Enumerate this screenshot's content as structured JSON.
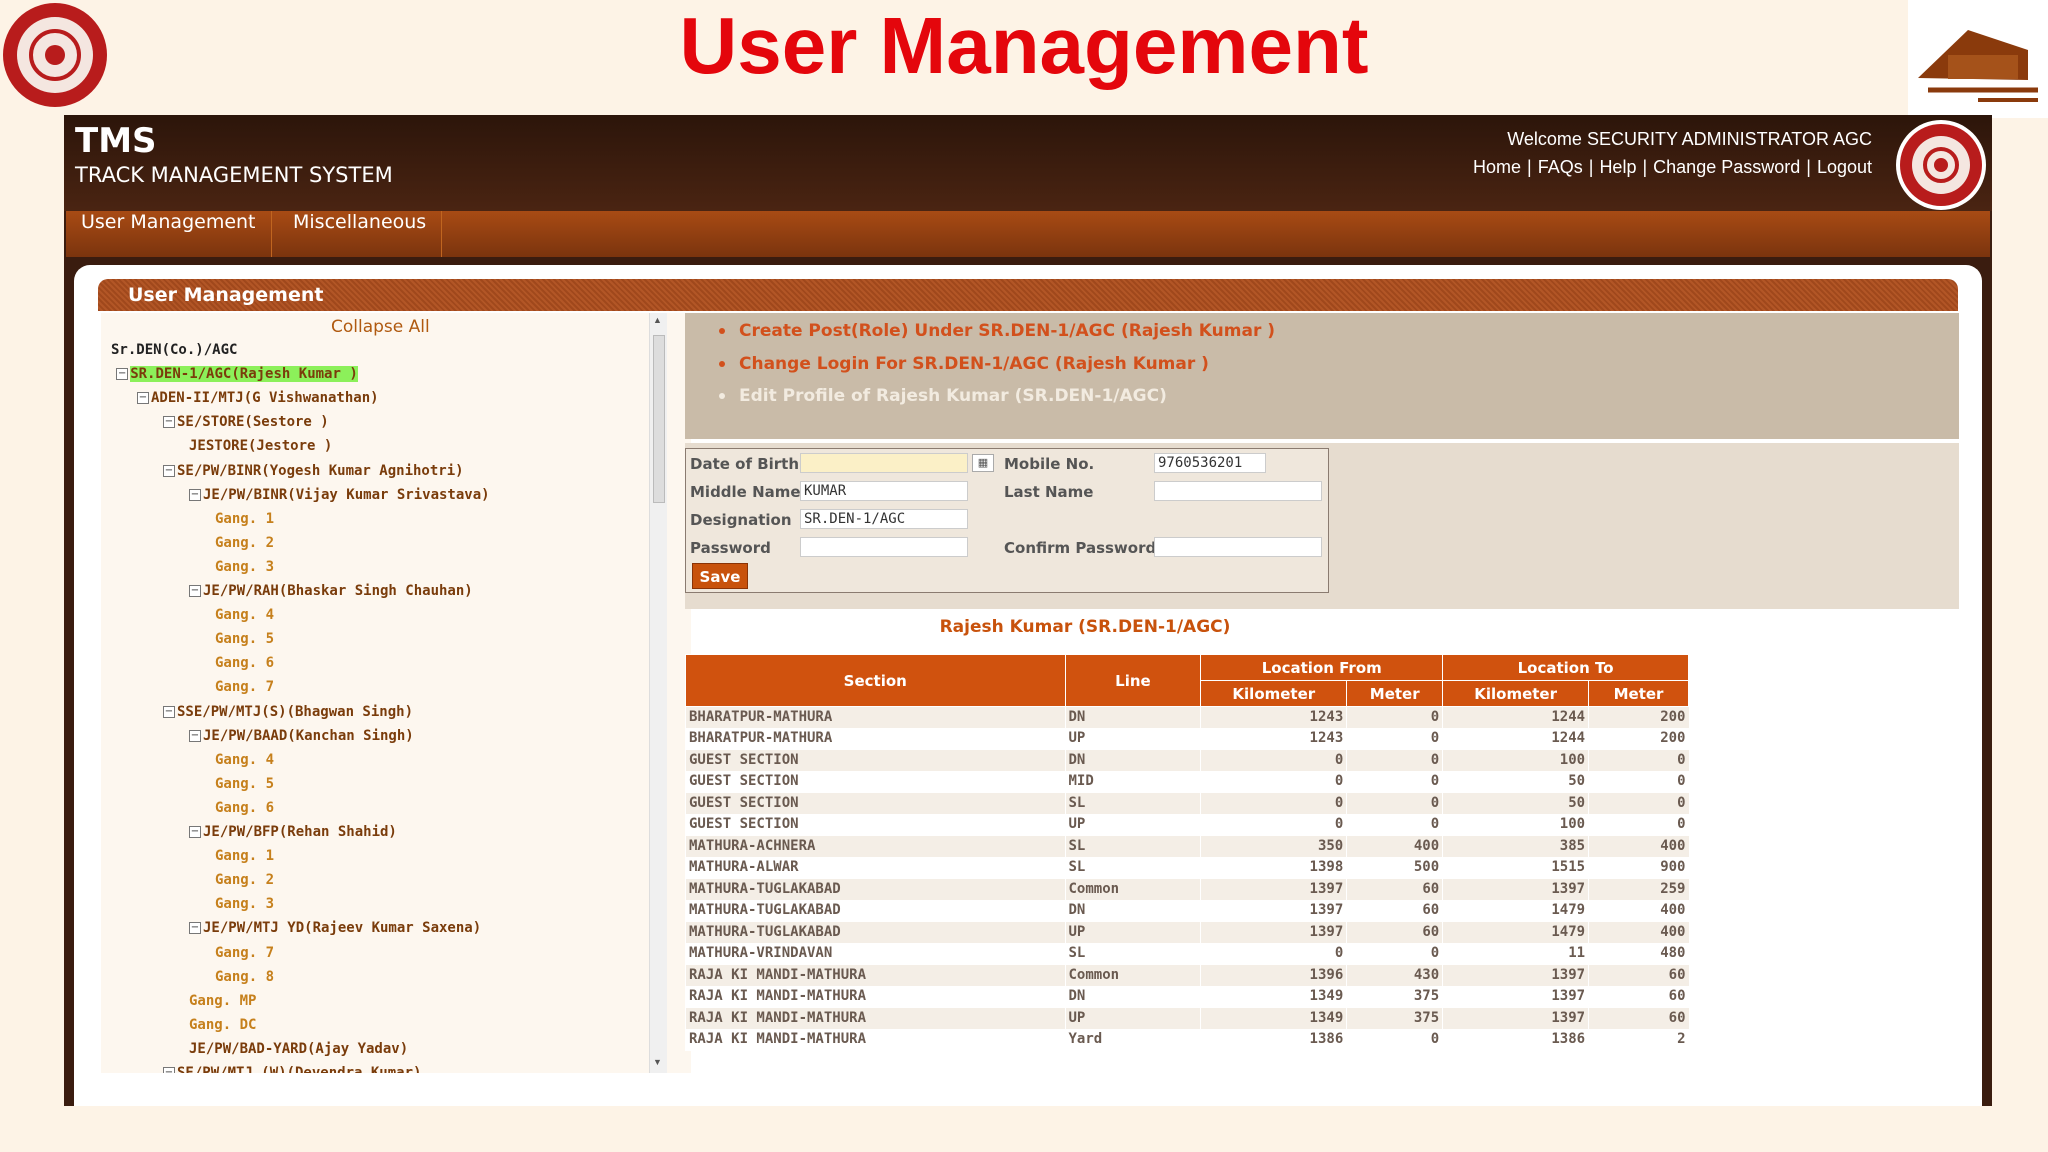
{
  "slide": {
    "title": "User Management"
  },
  "header": {
    "app_name": "TMS",
    "app_subtitle": "TRACK MANAGEMENT SYSTEM",
    "welcome": "Welcome SECURITY ADMINISTRATOR AGC",
    "links": [
      "Home",
      "FAQs",
      "Help",
      "Change Password",
      "Logout"
    ]
  },
  "nav": {
    "items": [
      "User Management",
      "Miscellaneous"
    ]
  },
  "panel": {
    "title": "User Management"
  },
  "tree": {
    "collapse_label": "Collapse All",
    "nodes": [
      {
        "label": "Sr.DEN(Co.)/AGC",
        "level": 0,
        "kind": "root"
      },
      {
        "label": "SR.DEN-1/AGC(Rajesh Kumar )",
        "level": 0,
        "kind": "selected",
        "toggle": "−"
      },
      {
        "label": "ADEN-II/MTJ(G Vishwanathan)",
        "level": 1,
        "toggle": "−"
      },
      {
        "label": "SE/STORE(Sestore )",
        "level": 2,
        "toggle": "−"
      },
      {
        "label": "JESTORE(Jestore )",
        "level": 3
      },
      {
        "label": "SE/PW/BINR(Yogesh Kumar Agnihotri)",
        "level": 2,
        "toggle": "−"
      },
      {
        "label": "JE/PW/BINR(Vijay Kumar Srivastava)",
        "level": 3,
        "toggle": "−"
      },
      {
        "label": "Gang. 1",
        "level": 4,
        "kind": "gang"
      },
      {
        "label": "Gang. 2",
        "level": 4,
        "kind": "gang"
      },
      {
        "label": "Gang. 3",
        "level": 4,
        "kind": "gang"
      },
      {
        "label": "JE/PW/RAH(Bhaskar Singh Chauhan)",
        "level": 3,
        "toggle": "−"
      },
      {
        "label": "Gang. 4",
        "level": 4,
        "kind": "gang"
      },
      {
        "label": "Gang. 5",
        "level": 4,
        "kind": "gang"
      },
      {
        "label": "Gang. 6",
        "level": 4,
        "kind": "gang"
      },
      {
        "label": "Gang. 7",
        "level": 4,
        "kind": "gang"
      },
      {
        "label": "SSE/PW/MTJ(S)(Bhagwan Singh)",
        "level": 2,
        "toggle": "−"
      },
      {
        "label": "JE/PW/BAAD(Kanchan Singh)",
        "level": 3,
        "toggle": "−"
      },
      {
        "label": "Gang. 4",
        "level": 4,
        "kind": "gang"
      },
      {
        "label": "Gang. 5",
        "level": 4,
        "kind": "gang"
      },
      {
        "label": "Gang. 6",
        "level": 4,
        "kind": "gang"
      },
      {
        "label": "JE/PW/BFP(Rehan Shahid)",
        "level": 3,
        "toggle": "−"
      },
      {
        "label": "Gang. 1",
        "level": 4,
        "kind": "gang"
      },
      {
        "label": "Gang. 2",
        "level": 4,
        "kind": "gang"
      },
      {
        "label": "Gang. 3",
        "level": 4,
        "kind": "gang"
      },
      {
        "label": "JE/PW/MTJ YD(Rajeev Kumar Saxena)",
        "level": 3,
        "toggle": "−"
      },
      {
        "label": "Gang. 7",
        "level": 4,
        "kind": "gang"
      },
      {
        "label": "Gang. 8",
        "level": 4,
        "kind": "gang"
      },
      {
        "label": "Gang. MP",
        "level": 3,
        "kind": "gang"
      },
      {
        "label": "Gang. DC",
        "level": 3,
        "kind": "gang"
      },
      {
        "label": "JE/PW/BAD-YARD(Ajay Yadav)",
        "level": 3
      },
      {
        "label": "SE/PW/MTJ (W)(Devendra Kumar)",
        "level": 2,
        "toggle": "−"
      }
    ]
  },
  "actions": [
    {
      "label": "Create Post(Role) Under SR.DEN-1/AGC (Rajesh Kumar )",
      "enabled": true
    },
    {
      "label": "Change Login For SR.DEN-1/AGC (Rajesh Kumar )",
      "enabled": true
    },
    {
      "label": "Edit Profile of Rajesh Kumar  (SR.DEN-1/AGC)",
      "enabled": false
    }
  ],
  "form": {
    "dob_label": "Date of Birth",
    "dob_value": "",
    "mobile_label": "Mobile No.",
    "mobile_value": "9760536201",
    "middle_label": "Middle Name",
    "middle_value": "KUMAR",
    "last_label": "Last Name",
    "last_value": "",
    "designation_label": "Designation",
    "designation_value": "SR.DEN-1/AGC",
    "password_label": "Password",
    "password_value": "",
    "confirm_label": "Confirm Password",
    "confirm_value": "",
    "save_label": "Save"
  },
  "table": {
    "caption": "Rajesh Kumar (SR.DEN-1/AGC)",
    "headers": {
      "section": "Section",
      "line": "Line",
      "from": "Location From",
      "to": "Location To",
      "km": "Kilometer",
      "m": "Meter"
    },
    "rows": [
      [
        "BHARATPUR-MATHURA",
        "DN",
        "1243",
        "0",
        "1244",
        "200"
      ],
      [
        "BHARATPUR-MATHURA",
        "UP",
        "1243",
        "0",
        "1244",
        "200"
      ],
      [
        "GUEST SECTION",
        "DN",
        "0",
        "0",
        "100",
        "0"
      ],
      [
        "GUEST SECTION",
        "MID",
        "0",
        "0",
        "50",
        "0"
      ],
      [
        "GUEST SECTION",
        "SL",
        "0",
        "0",
        "50",
        "0"
      ],
      [
        "GUEST SECTION",
        "UP",
        "0",
        "0",
        "100",
        "0"
      ],
      [
        "MATHURA-ACHNERA",
        "SL",
        "350",
        "400",
        "385",
        "400"
      ],
      [
        "MATHURA-ALWAR",
        "SL",
        "1398",
        "500",
        "1515",
        "900"
      ],
      [
        "MATHURA-TUGLAKABAD",
        "Common",
        "1397",
        "60",
        "1397",
        "259"
      ],
      [
        "MATHURA-TUGLAKABAD",
        "DN",
        "1397",
        "60",
        "1479",
        "400"
      ],
      [
        "MATHURA-TUGLAKABAD",
        "UP",
        "1397",
        "60",
        "1479",
        "400"
      ],
      [
        "MATHURA-VRINDAVAN",
        "SL",
        "0",
        "0",
        "11",
        "480"
      ],
      [
        "RAJA KI MANDI-MATHURA",
        "Common",
        "1396",
        "430",
        "1397",
        "60"
      ],
      [
        "RAJA KI MANDI-MATHURA",
        "DN",
        "1349",
        "375",
        "1397",
        "60"
      ],
      [
        "RAJA KI MANDI-MATHURA",
        "UP",
        "1349",
        "375",
        "1397",
        "60"
      ],
      [
        "RAJA KI MANDI-MATHURA",
        "Yard",
        "1386",
        "0",
        "1386",
        "2"
      ]
    ]
  }
}
